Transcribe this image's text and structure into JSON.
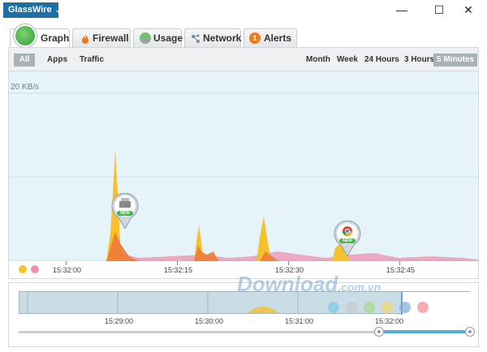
{
  "app": {
    "title": "GlassWire"
  },
  "window": {
    "minimize": "—",
    "maximize": "☐",
    "close": "✕"
  },
  "tabs": [
    {
      "label": "Graph",
      "icon": "glasswire-logo-icon",
      "active": true
    },
    {
      "label": "Firewall",
      "icon": "flame-icon"
    },
    {
      "label": "Usage",
      "icon": "usage-icon"
    },
    {
      "label": "Network",
      "icon": "network-icon"
    },
    {
      "label": "Alerts",
      "icon": "alert-icon",
      "badge": "1"
    }
  ],
  "filters": [
    "All",
    "Apps",
    "Traffic"
  ],
  "ranges": [
    "Month",
    "Week",
    "24 Hours",
    "3 Hours",
    "5 Minutes"
  ],
  "selected_range": "5 Minutes",
  "graph": {
    "y_label": "20 KB/s",
    "time_labels": [
      "15:32:00",
      "15:32:15",
      "15:32:30",
      "15:32:45"
    ],
    "pins": [
      {
        "label": "NEW",
        "icon": "printer-app-icon"
      },
      {
        "label": "NEW",
        "icon": "chrome-app-icon"
      }
    ]
  },
  "overview": {
    "time_labels": [
      "15:29:00",
      "15:30:00",
      "15:31:00",
      "15:32:00"
    ]
  },
  "watermark": {
    "text": "Download",
    "suffix": ".com.vn"
  },
  "colors": {
    "accent": "#1d6fa5",
    "incoming": "#f6c12c",
    "outgoing": "#f07a3a",
    "other": "#ee8fb0",
    "graph_bg": "#e6f4fa"
  }
}
